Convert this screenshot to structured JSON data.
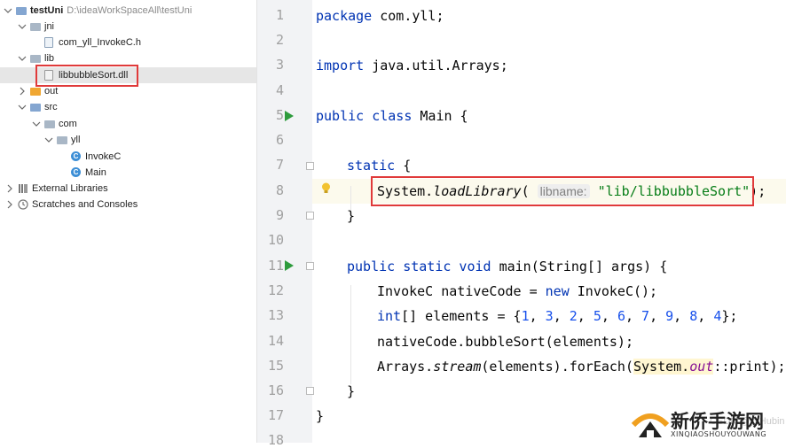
{
  "tree": {
    "project": {
      "name": "testUni",
      "path": "D:\\ideaWorkSpaceAll\\testUni"
    },
    "jni_folder": "jni",
    "jni_file": "com_yll_InvokeC.h",
    "lib_folder": "lib",
    "lib_file": "libbubbleSort.dll",
    "out_folder": "out",
    "src_folder": "src",
    "com_package": "com",
    "yll_package": "yll",
    "class_invoke": "InvokeC",
    "class_main": "Main",
    "external_libraries": "External Libraries",
    "scratches": "Scratches and Consoles"
  },
  "editor": {
    "line_numbers": [
      "1",
      "2",
      "3",
      "4",
      "5",
      "6",
      "7",
      "8",
      "9",
      "10",
      "11",
      "12",
      "13",
      "14",
      "15",
      "16",
      "17",
      "18"
    ],
    "code": {
      "l1_kw": "package",
      "l1_rest": " com.yll;",
      "l3_kw": "import",
      "l3_rest": " java.util.Arrays;",
      "l5_kw": "public class",
      "l5_rest": " Main {",
      "l7_kw": "static",
      "l7_rest": " {",
      "l8_sys": "System.",
      "l8_method": "loadLibrary",
      "l8_open": "( ",
      "l8_hint": "libname:",
      "l8_str": "\"lib/libbubbleSort\"",
      "l8_close": ");",
      "l9": "}",
      "l11_kw": "public static void",
      "l11_rest": " main(String[] args) {",
      "l12_a": "InvokeC nativeCode = ",
      "l12_kw": "new",
      "l12_b": " InvokeC();",
      "l13_kw": "int",
      "l13_a": "[] elements = {",
      "l13_nums": [
        "1",
        "3",
        "2",
        "5",
        "6",
        "7",
        "9",
        "8",
        "4"
      ],
      "l13_close": "};",
      "l14": "nativeCode.bubbleSort(elements);",
      "l15_a": "Arrays.",
      "l15_method": "stream",
      "l15_b": "(elements).forEach(",
      "l15_sys": "System.",
      "l15_field": "out",
      "l15_c": "::print);",
      "l16": "}",
      "l17": "}"
    }
  },
  "watermark": {
    "title": "新侨手游网",
    "subtitle": "XINQIAOSHOUYOUWANG",
    "csdn": "CSDN @yllHubin"
  },
  "colors": {
    "highlight_box": "#e03a3a",
    "keyword": "#0033b3",
    "string": "#067d17",
    "number": "#1750eb",
    "run_icon": "#2d9b3c"
  }
}
